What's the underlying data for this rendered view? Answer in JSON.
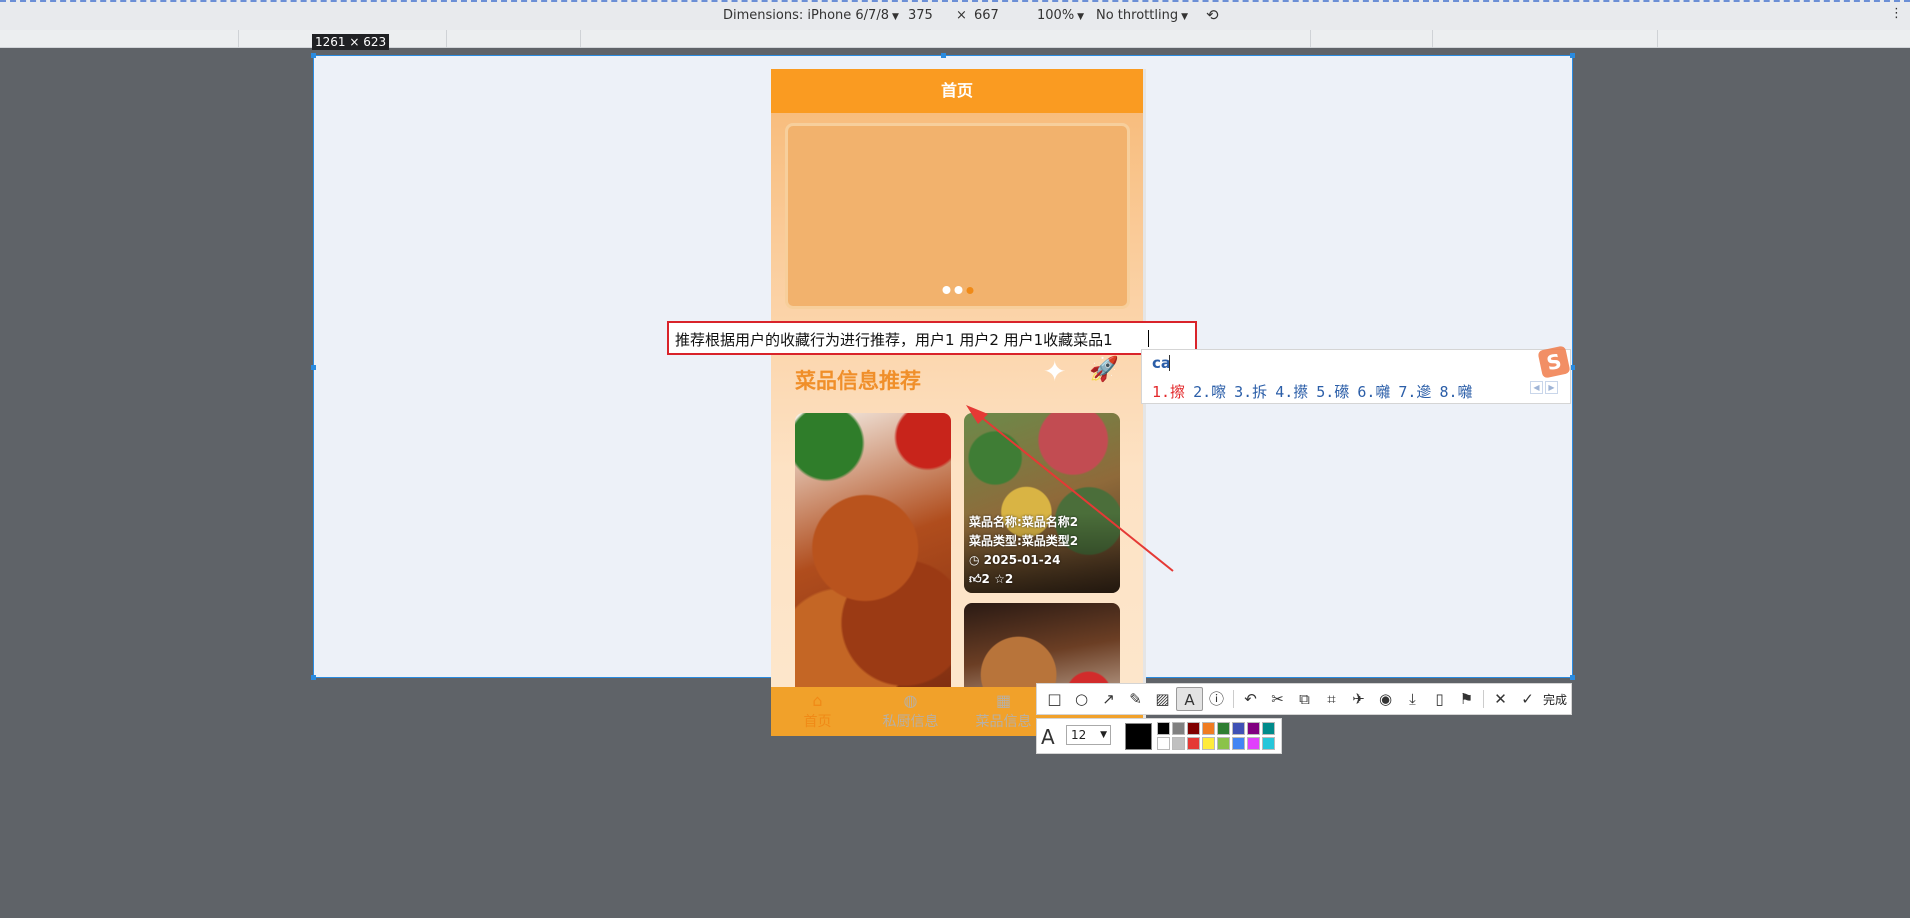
{
  "devtools": {
    "dimensions_label": "Dimensions: iPhone 6/7/8",
    "width": "375",
    "times": "×",
    "height": "667",
    "zoom": "100%",
    "throttling": "No throttling",
    "viewport_size_badge": "1261 × 623"
  },
  "phone": {
    "header_title": "首页",
    "carousel_dots": 3,
    "section_title": "菜品信息推荐",
    "dish_card": {
      "name": "菜品名称:菜品名称2",
      "type": "菜品类型:菜品类型2",
      "date": "2025-01-24",
      "likes": "2",
      "favorites": "2"
    },
    "tabs": [
      {
        "label": "首页",
        "icon": "home-icon"
      },
      {
        "label": "私厨信息",
        "icon": "chef-icon"
      },
      {
        "label": "菜品信息",
        "icon": "dish-icon"
      },
      {
        "label": "",
        "icon": "profile-icon"
      }
    ]
  },
  "annotation": {
    "text": "推荐根据用户的收藏行为进行推荐，用户1 用户2 用户1收藏菜品1",
    "border_color": "#d9232a"
  },
  "ime": {
    "input": "ca",
    "candidates": [
      "1.擦",
      "2.嚓",
      "3.拆",
      "4.攃",
      "5.礤",
      "6.囃",
      "7.遪",
      "8.囃"
    ]
  },
  "screenshot_tool": {
    "done_label": "完成",
    "font_size": "12",
    "current_color": "#000000",
    "palette": [
      "#000000",
      "#808080",
      "#800000",
      "#f07c22",
      "#2e7d32",
      "#3f51b5",
      "#800080",
      "#008b8b",
      "#ffffff",
      "#c0c0c0",
      "#e53935",
      "#ffeb3b",
      "#8bc34a",
      "#4285f4",
      "#e040fb",
      "#26c6da"
    ]
  },
  "colors": {
    "header": "#fa9b21",
    "section_title": "#f08f2a",
    "viewport_border": "#2a8be0"
  }
}
